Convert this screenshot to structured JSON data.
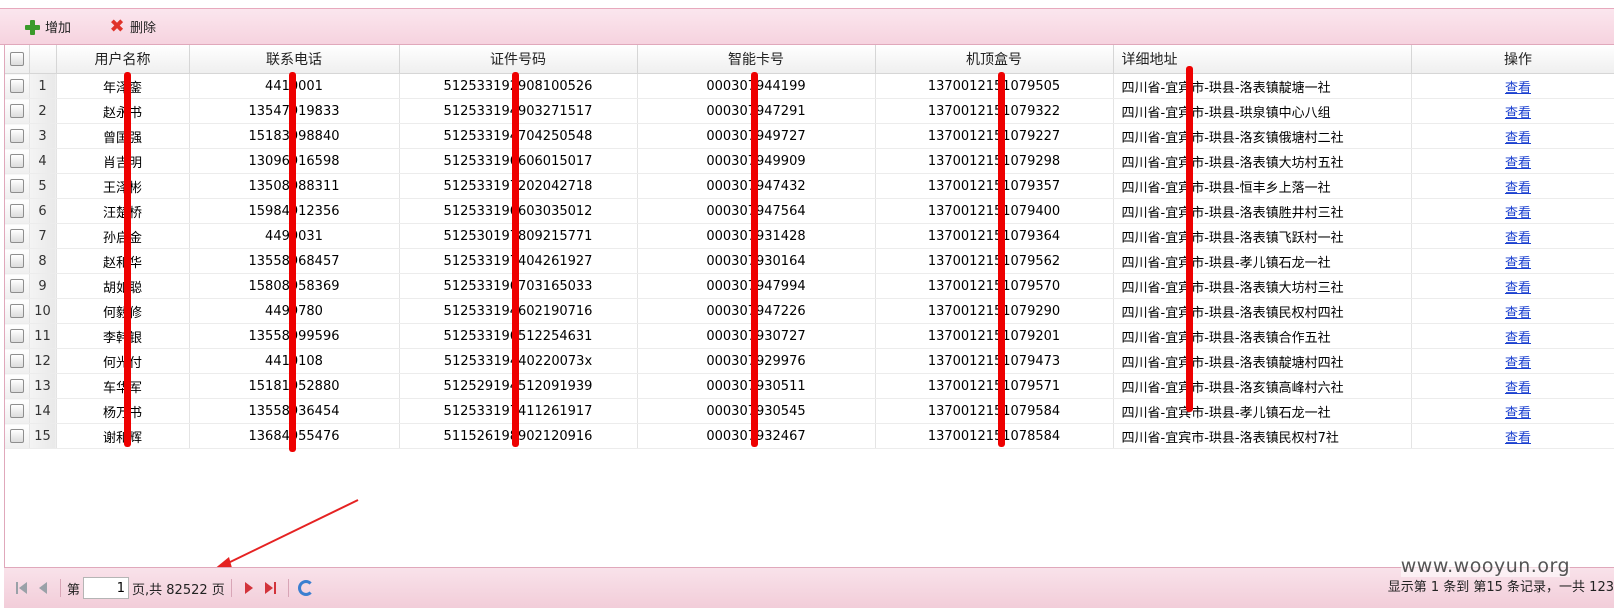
{
  "toolbar": {
    "add_label": "增加",
    "delete_label": "删除"
  },
  "grid": {
    "columns": [
      "用户名称",
      "联系电话",
      "证件号码",
      "智能卡号",
      "机顶盒号",
      "详细地址",
      "操作"
    ],
    "rows": [
      {
        "num": "1",
        "name": "年泽銮",
        "phone": "4410001",
        "id": "512533192908100526",
        "card": "000307944199",
        "stb": "1370012151079505",
        "addr": "四川省-宜宾市-珙县-洛表镇靛塘一社",
        "op": "查看"
      },
      {
        "num": "2",
        "name": "赵永书",
        "phone": "13547919833",
        "id": "512533194903271517",
        "card": "000307947291",
        "stb": "1370012151079322",
        "addr": "四川省-宜宾市-珙县-珙泉镇中心八组",
        "op": "查看"
      },
      {
        "num": "3",
        "name": "曾国强",
        "phone": "15183998840",
        "id": "512533194704250548",
        "card": "000307949727",
        "stb": "1370012151079227",
        "addr": "四川省-宜宾市-珙县-洛亥镇俄塘村二社",
        "op": "查看"
      },
      {
        "num": "4",
        "name": "肖吉明",
        "phone": "13096916598",
        "id": "512533196606015017",
        "card": "000307949909",
        "stb": "1370012151079298",
        "addr": "四川省-宜宾市-珙县-洛表镇大坊村五社",
        "op": "查看"
      },
      {
        "num": "5",
        "name": "王泽彬",
        "phone": "13508988311",
        "id": "512533197202042718",
        "card": "000307947432",
        "stb": "1370012151079357",
        "addr": "四川省-宜宾市-珙县-恒丰乡上落一社",
        "op": "查看"
      },
      {
        "num": "6",
        "name": "汪楚桥",
        "phone": "15984912356",
        "id": "512533196603035012",
        "card": "000307947564",
        "stb": "1370012151079400",
        "addr": "四川省-宜宾市-珙县-洛表镇胜井村三社",
        "op": "查看"
      },
      {
        "num": "7",
        "name": "孙启金",
        "phone": "4499031",
        "id": "512530197809215771",
        "card": "000307931428",
        "stb": "1370012151079364",
        "addr": "四川省-宜宾市-珙县-洛表镇飞跃村一社",
        "op": "查看"
      },
      {
        "num": "8",
        "name": "赵和华",
        "phone": "13558968457",
        "id": "512533197404261927",
        "card": "000307930164",
        "stb": "1370012151079562",
        "addr": "四川省-宜宾市-珙县-孝儿镇石龙一社",
        "op": "查看"
      },
      {
        "num": "9",
        "name": "胡如聪",
        "phone": "15808958369",
        "id": "512533196703165033",
        "card": "000307947994",
        "stb": "1370012151079570",
        "addr": "四川省-宜宾市-珙县-洛表镇大坊村三社",
        "op": "查看"
      },
      {
        "num": "10",
        "name": "何毅修",
        "phone": "4499780",
        "id": "512533194602190716",
        "card": "000307947226",
        "stb": "1370012151079290",
        "addr": "四川省-宜宾市-珙县-洛表镇民权村四社",
        "op": "查看"
      },
      {
        "num": "11",
        "name": "李韩银",
        "phone": "13558999596",
        "id": "512533196512254631",
        "card": "000307930727",
        "stb": "1370012151079201",
        "addr": "四川省-宜宾市-珙县-洛表镇合作五社",
        "op": "查看"
      },
      {
        "num": "12",
        "name": "何光付",
        "phone": "4410108",
        "id": "51253319440220073x",
        "card": "000307929976",
        "stb": "1370012151079473",
        "addr": "四川省-宜宾市-珙县-洛表镇靛塘村四社",
        "op": "查看"
      },
      {
        "num": "13",
        "name": "车华军",
        "phone": "15181952880",
        "id": "512529194512091939",
        "card": "000307930511",
        "stb": "1370012151079571",
        "addr": "四川省-宜宾市-珙县-洛亥镇高峰村六社",
        "op": "查看"
      },
      {
        "num": "14",
        "name": "杨万书",
        "phone": "13558936454",
        "id": "512533197411261917",
        "card": "000307930545",
        "stb": "1370012151079584",
        "addr": "四川省-宜宾市-珙县-孝儿镇石龙一社",
        "op": "查看"
      },
      {
        "num": "15",
        "name": "谢和辉",
        "phone": "13684955476",
        "id": "511526198902120916",
        "card": "000307932467",
        "stb": "1370012151078584",
        "addr": "四川省-宜宾市-珙县-洛表镇民权村7社",
        "op": "查看"
      }
    ]
  },
  "pager": {
    "page_prefix": "第",
    "page_value": "1",
    "page_suffix": "页,共 82522 页",
    "summary": "显示第 1 条到 第15 条记录，一共 123"
  },
  "watermark": "www.wooyun.org",
  "colors": {
    "toolbar_bg": "#f6d3df",
    "link": "#1a3fcf",
    "redaction": "#ee0000"
  }
}
